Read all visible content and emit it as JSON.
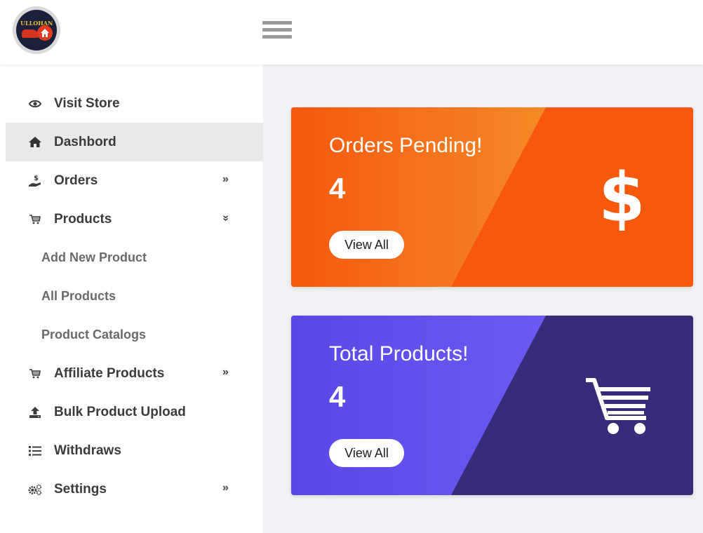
{
  "header": {
    "logo_text": "ULLOHAN",
    "logo_icon": "brand-logo-icon",
    "menu_icon": "hamburger-icon"
  },
  "sidebar": {
    "items": [
      {
        "label": "Visit Store",
        "icon": "eye-icon"
      },
      {
        "label": "Dashbord",
        "icon": "home-icon",
        "active": true
      },
      {
        "label": "Orders",
        "icon": "hand-dollar-icon",
        "arrow": "»"
      },
      {
        "label": "Products",
        "icon": "cart-icon",
        "arrow": "»",
        "expanded": true
      },
      {
        "label": "Add New Product"
      },
      {
        "label": "All Products"
      },
      {
        "label": "Product Catalogs"
      },
      {
        "label": "Affiliate Products",
        "icon": "cart-icon",
        "arrow": "»"
      },
      {
        "label": "Bulk Product Upload",
        "icon": "upload-icon"
      },
      {
        "label": "Withdraws",
        "icon": "list-icon"
      },
      {
        "label": "Settings",
        "icon": "cogs-icon",
        "arrow": "»"
      }
    ]
  },
  "cards": [
    {
      "title": "Orders Pending!",
      "count": "4",
      "button": "View All",
      "icon": "dollar-icon",
      "colors": {
        "left_start": "#f6580f",
        "left_end": "#f48a26",
        "right": "#f7580b"
      }
    },
    {
      "title": "Total Products!",
      "count": "4",
      "button": "View All",
      "icon": "shopping-cart-icon",
      "colors": {
        "left_start": "#5a48e6",
        "left_end": "#6a5af2",
        "right": "#372c7a"
      }
    }
  ]
}
